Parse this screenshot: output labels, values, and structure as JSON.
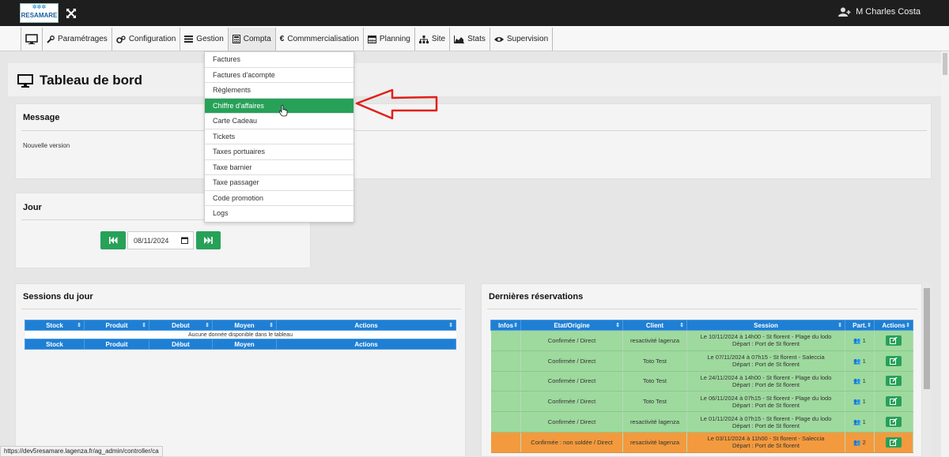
{
  "topbar": {
    "logo_text": "RESAMARE",
    "user_name": "M Charles Costa"
  },
  "menu": [
    {
      "label": "",
      "icon": "monitor-icon"
    },
    {
      "label": "Paramétrages",
      "icon": "wrench-icon"
    },
    {
      "label": "Configuration",
      "icon": "cogs-icon"
    },
    {
      "label": "Gestion",
      "icon": "list-icon"
    },
    {
      "label": "Compta",
      "icon": "calculator-icon"
    },
    {
      "label": "Commmercialisation",
      "icon": "euro-icon"
    },
    {
      "label": "Planning",
      "icon": "calendar-icon"
    },
    {
      "label": "Site",
      "icon": "sitemap-icon"
    },
    {
      "label": "Stats",
      "icon": "area-chart-icon"
    },
    {
      "label": "Supervision",
      "icon": "eye-icon"
    }
  ],
  "compta_dropdown": [
    "Factures",
    "Factures d'acompte",
    "Règlements",
    "Chiffre d'affaires",
    "Carte Cadeau",
    "Tickets",
    "Taxes portuaires",
    "Taxe barnier",
    "Taxe passager",
    "Code promotion",
    "Logs"
  ],
  "page": {
    "title": "Tableau de bord"
  },
  "message": {
    "title": "Message",
    "text": "Nouvelle version"
  },
  "jour": {
    "title": "Jour",
    "date": "08/11/2024"
  },
  "sessions": {
    "title": "Sessions du jour",
    "headers": [
      "Stock",
      "Produit",
      "Debut",
      "Moyen",
      "Actions"
    ],
    "footer_headers": [
      "Stock",
      "Produit",
      "Début",
      "Moyen",
      "Actions"
    ],
    "empty_text": "Aucune donnée disponible dans le tableau"
  },
  "reservations": {
    "title": "Dernières réservations",
    "headers": [
      "Infos",
      "Etat/Origine",
      "Client",
      "Session",
      "Part.",
      "Actions"
    ],
    "rows": [
      {
        "etat": "Confirmée / Direct",
        "client": "resactivité lagenza",
        "session1": "Le 10/11/2024 à 14h00 - St florent - Plage du lodo",
        "session2": "Départ : Port de St florent",
        "part": "1",
        "status": "green"
      },
      {
        "etat": "Confirmée / Direct",
        "client": "Toto Test",
        "session1": "Le 07/11/2024 à 07h15 - St florent - Saleccia",
        "session2": "Départ : Port de St florent",
        "part": "1",
        "status": "green"
      },
      {
        "etat": "Confirmée / Direct",
        "client": "Toto Test",
        "session1": "Le 24/11/2024 à 14h00 - St florent - Plage du lodo",
        "session2": "Départ : Port de St florent",
        "part": "1",
        "status": "green"
      },
      {
        "etat": "Confirmée / Direct",
        "client": "Toto Test",
        "session1": "Le 06/11/2024 à 07h15 - St florent - Plage du lodo",
        "session2": "Départ : Port de St florent",
        "part": "1",
        "status": "green"
      },
      {
        "etat": "Confirmée / Direct",
        "client": "resactivité lagenza",
        "session1": "Le 01/11/2024 à 07h15 - St florent - Plage du lodo",
        "session2": "Départ : Port de St florent",
        "part": "1",
        "status": "green"
      },
      {
        "etat": "Confirmée : non soldée / Direct",
        "client": "resactivité lagenza",
        "session1": "Le 03/11/2024 à 11h00 - St florent - Saleccia",
        "session2": "Départ : Port de St florent",
        "part": "2",
        "status": "orange"
      }
    ]
  },
  "statusbar": {
    "url": "https://dev5resamare.lagenza.fr/ag_admin/controller/ca"
  },
  "colors": {
    "primary_green": "#27a158",
    "table_header_blue": "#1e7fd4",
    "row_green": "#9ed99e",
    "row_orange": "#f39a3e",
    "annotation_red": "#e0201a"
  }
}
